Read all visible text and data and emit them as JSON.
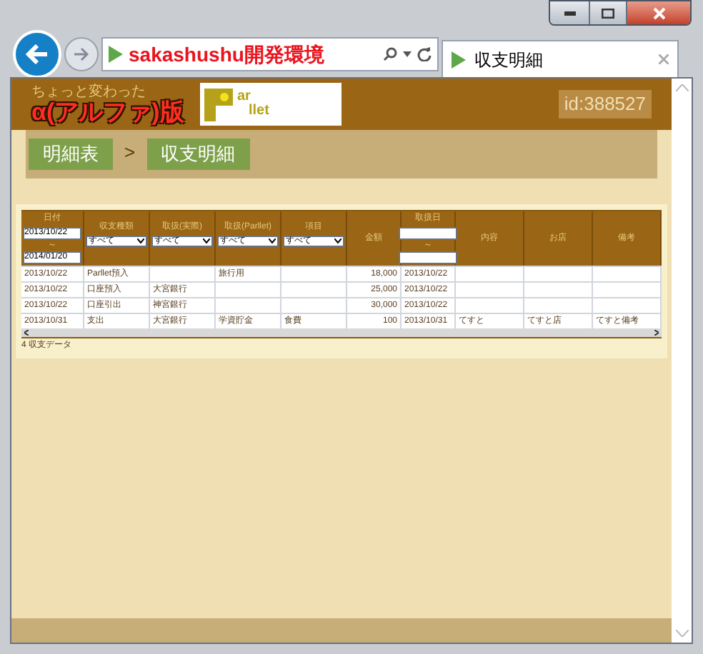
{
  "browser": {
    "address": "sakashushu開発環境",
    "tab_title": "収支明細"
  },
  "header": {
    "tagline": "ちょっと変わった",
    "edition": "α(アルファ)版",
    "logo_top": "ar",
    "logo_bottom": "llet",
    "user_id": "id:388527"
  },
  "breadcrumb": {
    "items": [
      "明細表",
      "収支明細"
    ],
    "separator": ">"
  },
  "table": {
    "columns": [
      {
        "label": "日付",
        "kind": "date_range",
        "from": "2013/10/22",
        "sep": "～",
        "to": "2014/01/20"
      },
      {
        "label": "収支種類",
        "kind": "select",
        "value": "すべて"
      },
      {
        "label": "取扱(実際)",
        "kind": "select",
        "value": "すべて"
      },
      {
        "label": "取扱(Parllet)",
        "kind": "select",
        "value": "すべて"
      },
      {
        "label": "項目",
        "kind": "select",
        "value": "すべて"
      },
      {
        "label": "金額",
        "kind": "plain"
      },
      {
        "label": "取扱日",
        "kind": "date_range",
        "sep": "～"
      },
      {
        "label": "内容",
        "kind": "plain"
      },
      {
        "label": "お店",
        "kind": "plain"
      },
      {
        "label": "備考",
        "kind": "plain"
      }
    ],
    "rows": [
      [
        "2013/10/22",
        "Parllet預入",
        "",
        "旅行用",
        "",
        "18,000",
        "2013/10/22",
        "",
        "",
        ""
      ],
      [
        "2013/10/22",
        "口座預入",
        "大宮銀行",
        "",
        "",
        "25,000",
        "2013/10/22",
        "",
        "",
        ""
      ],
      [
        "2013/10/22",
        "口座引出",
        "神宮銀行",
        "",
        "",
        "30,000",
        "2013/10/22",
        "",
        "",
        ""
      ],
      [
        "2013/10/31",
        "支出",
        "大宮銀行",
        "学資貯金",
        "食費",
        "100",
        "2013/10/31",
        "てすと",
        "てすと店",
        "てすと備考"
      ]
    ],
    "count": "4 収支データ"
  }
}
